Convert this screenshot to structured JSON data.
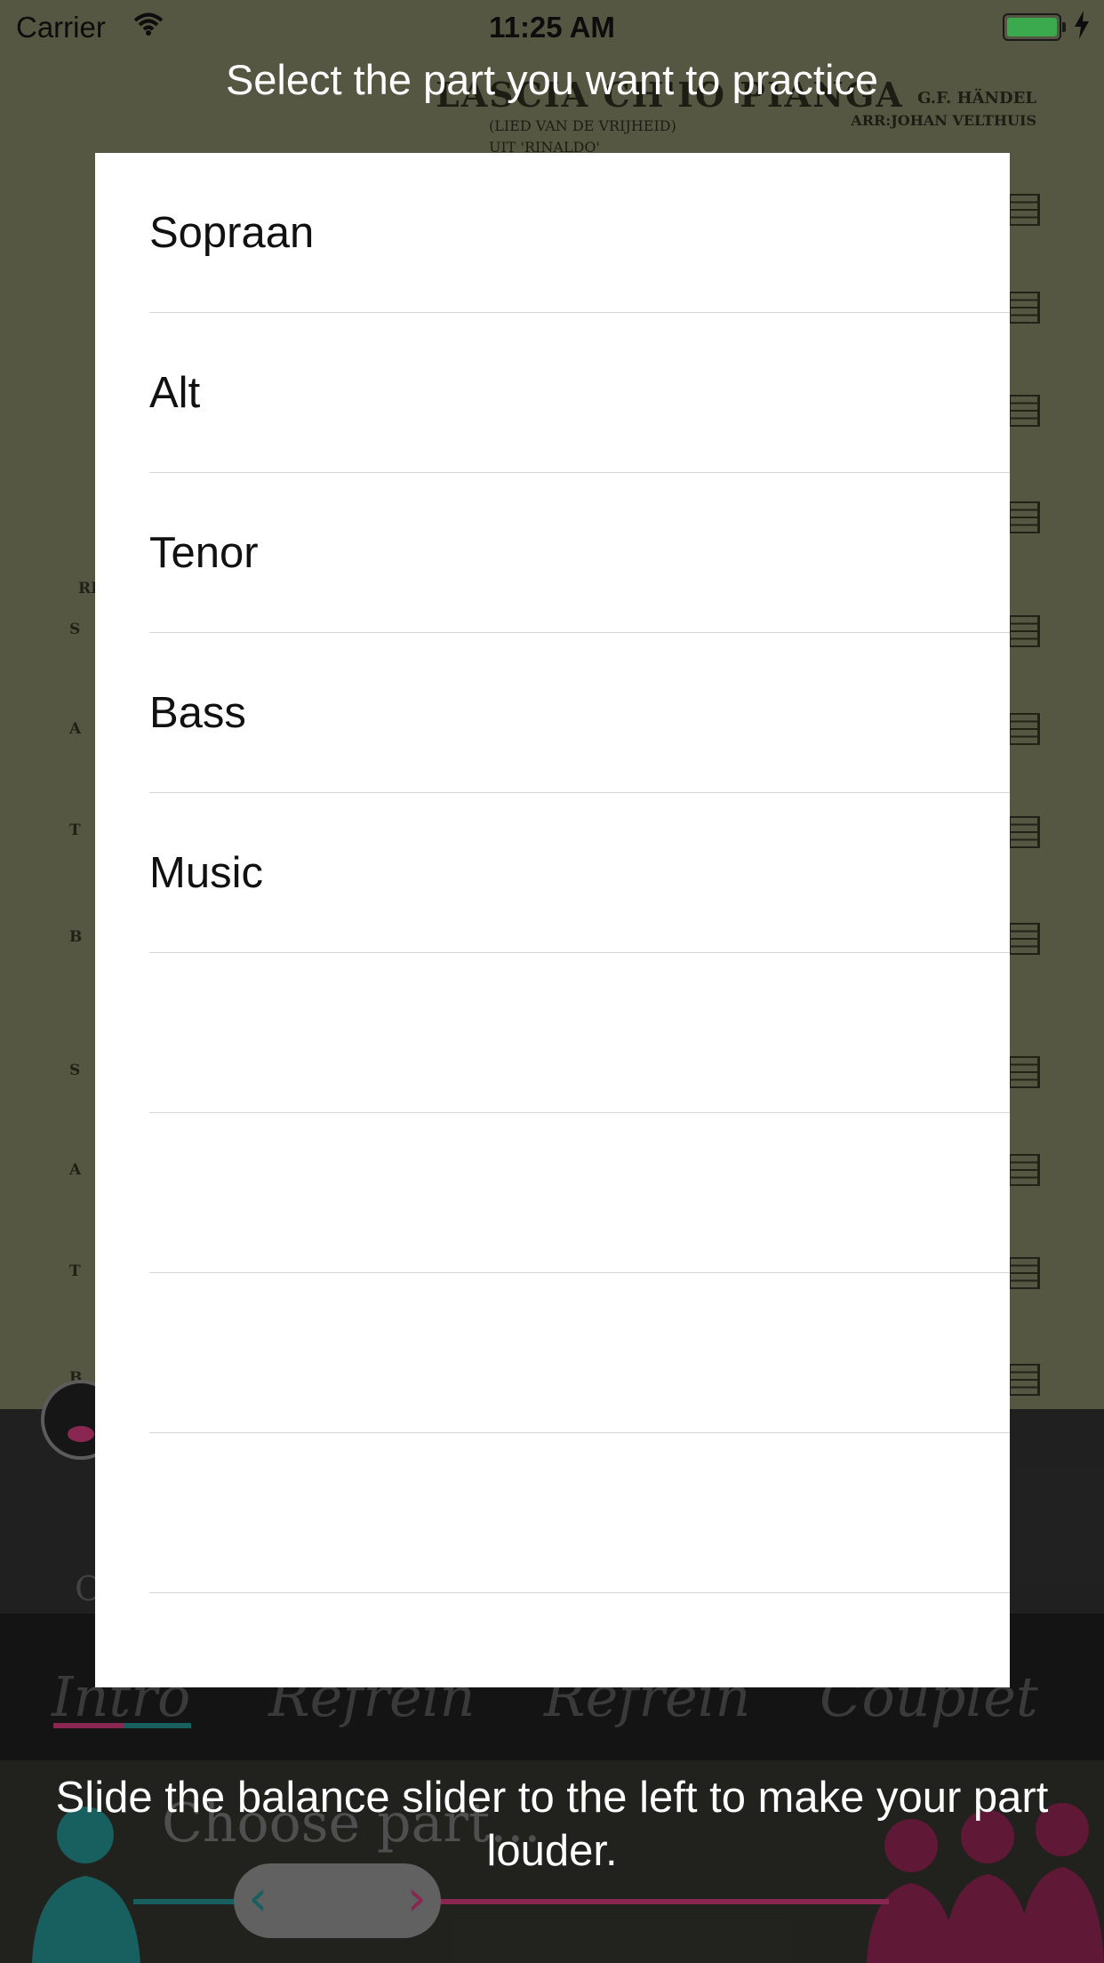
{
  "status_bar": {
    "carrier": "Carrier",
    "time": "11:25 AM"
  },
  "score": {
    "title": "LASCIA CH'IO PIANGA",
    "subtitle_1": "(LIED VAN DE VRIJHEID)",
    "subtitle_2": "UIT 'RINALDO'",
    "composer": "G.F. HÄNDEL",
    "arranger": "ARR:JOHAN VELTHUIS",
    "rehearsal_mark": "RE",
    "voice_letters": [
      "S",
      "A",
      "T",
      "B",
      "S",
      "A",
      "T",
      "B"
    ]
  },
  "modal": {
    "title": "Select the part you want to practice",
    "parts": [
      "Sopraan",
      "Alt",
      "Tenor",
      "Bass",
      "Music",
      "",
      "",
      "",
      "",
      ""
    ],
    "hint": "Slide the balance slider to the left to make your part louder."
  },
  "background_controls": {
    "sections": [
      "Intro",
      "Refrein",
      "Refrein",
      "Couplet"
    ],
    "choose_part": "Choose part...",
    "side_letter": "O"
  },
  "colors": {
    "accent_teal": "#1f7a7a",
    "accent_magenta": "#b0336a",
    "battery": "#4cd964"
  },
  "icons": [
    "wifi-icon",
    "battery-icon",
    "charge-icon",
    "chevron-left-icon",
    "chevron-right-icon"
  ]
}
